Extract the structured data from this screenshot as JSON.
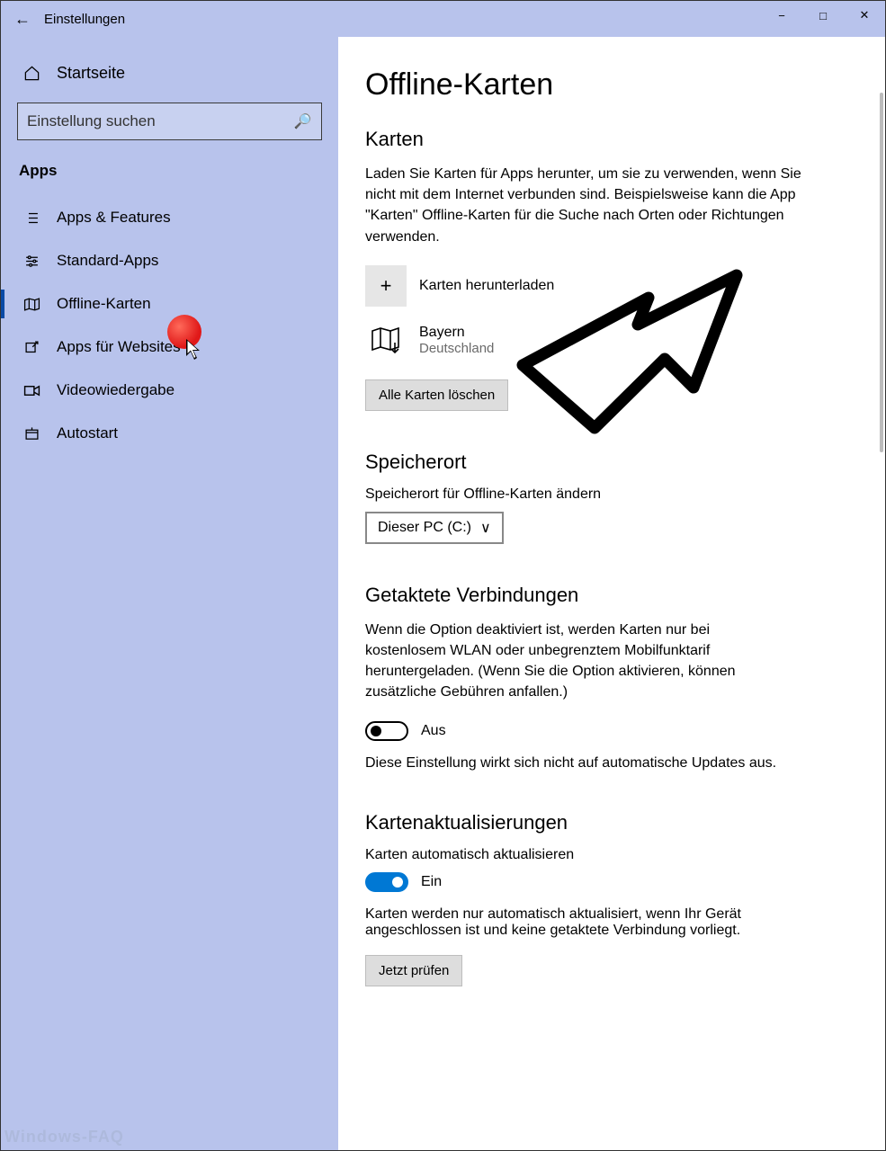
{
  "titlebar": {
    "title": "Einstellungen"
  },
  "sidebar": {
    "home": "Startseite",
    "search_placeholder": "Einstellung suchen",
    "group": "Apps",
    "items": [
      {
        "label": "Apps & Features"
      },
      {
        "label": "Standard-Apps"
      },
      {
        "label": "Offline-Karten"
      },
      {
        "label": "Apps für Websites"
      },
      {
        "label": "Videowiedergabe"
      },
      {
        "label": "Autostart"
      }
    ]
  },
  "main": {
    "heading": "Offline-Karten",
    "karten": {
      "title": "Karten",
      "desc": "Laden Sie Karten für Apps herunter, um sie zu verwenden, wenn Sie nicht mit dem Internet verbunden sind. Beispielsweise kann die App \"Karten\" Offline-Karten für die Suche nach Orten oder Richtungen verwenden.",
      "download_btn": "Karten herunterladen",
      "map_name": "Bayern",
      "map_sub": "Deutschland",
      "delete_all": "Alle Karten löschen"
    },
    "storage": {
      "title": "Speicherort",
      "label": "Speicherort für Offline-Karten ändern",
      "value": "Dieser PC (C:)"
    },
    "metered": {
      "title": "Getaktete Verbindungen",
      "desc": "Wenn die Option deaktiviert ist, werden Karten nur bei kostenlosem WLAN oder unbegrenztem Mobilfunktarif heruntergeladen. (Wenn Sie die Option aktivieren, können zusätzliche Gebühren anfallen.)",
      "state": "Aus",
      "note": "Diese Einstellung wirkt sich nicht auf automatische Updates aus."
    },
    "updates": {
      "title": "Kartenaktualisierungen",
      "label": "Karten automatisch aktualisieren",
      "state": "Ein",
      "note": "Karten werden nur automatisch aktualisiert, wenn Ihr Gerät angeschlossen ist und keine getaktete Verbindung vorliegt.",
      "check_btn": "Jetzt prüfen"
    }
  },
  "watermark": "Windows-FAQ"
}
